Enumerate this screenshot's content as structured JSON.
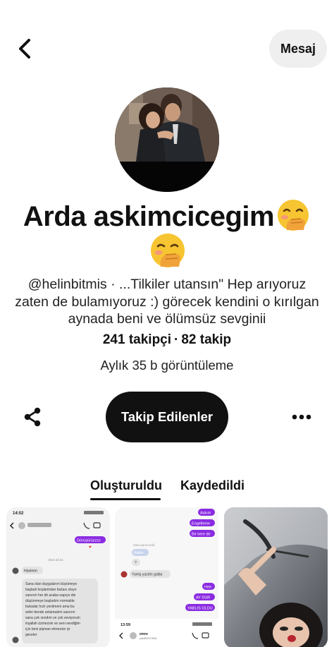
{
  "header": {
    "back_icon": "chevron-left-icon",
    "message_button": "Mesaj"
  },
  "profile": {
    "name": "Arda askimcicegim",
    "name_emoji": "face-with-hand-over-mouth-emoji",
    "bio_lines": [
      "@helinbitmis · ...Tilkiler utansın\" Hep arıyoruz",
      "zaten de bulamıyoruz :) görecek kendini o kırılgan",
      "aynada beni ve ölümsüz sevginii"
    ],
    "followers": "241 takipçi",
    "separator": "·",
    "following": "82 takip",
    "monthly_views": "Aylık 35 b görüntüleme"
  },
  "actions": {
    "share_icon": "share-icon",
    "follow_button": "Takip Edilenler",
    "more_icon": "more-horizontal-icon"
  },
  "tabs": [
    {
      "label": "Oluşturuldu",
      "active": true
    },
    {
      "label": "Kaydedildi",
      "active": false
    }
  ],
  "pins": [
    {
      "kind": "chat-screenshot",
      "status_time": "14:02",
      "date_divider": "Dün 22:21",
      "outgoing": "Görüşürüzzzz",
      "incoming_short": "Havinnn",
      "incoming_long": [
        "Sana olan duygularım büyümeye",
        "başladı hoşlantıdan fazlası oluyo",
        "sanırım her dk acaba napıyo die",
        "düşünmeye başladım normalde",
        "bukadar hızlı yenilmem ama bu",
        "sefer bende anlamadım sanırım",
        "sana çok ısındım ve çok seviyorum",
        "inşallah üzmezsin ve seni sevdiğim",
        "için beni pişman etmezsin iyi",
        "geceler"
      ]
    },
    {
      "kind": "chat-screenshot",
      "outgoing_top": [
        "Askım",
        "Engelleme",
        "Bir kere de"
      ],
      "system_note": "Sana yanıt verdi",
      "incoming_1": "Askim",
      "incoming_2": "?",
      "incoming_3": "Yanlış yazdın galba",
      "outgoing_bottom": [
        "Hee",
        "AY DUR",
        "YABLIS OLDU"
      ],
      "status_time": "13:59",
      "contact_name": "emre",
      "contact_handle": "yak852973651"
    },
    {
      "kind": "photo"
    }
  ],
  "colors": {
    "accent": "#111111",
    "chip_bg": "#efefef",
    "chat_purple": "#8a2be2"
  }
}
